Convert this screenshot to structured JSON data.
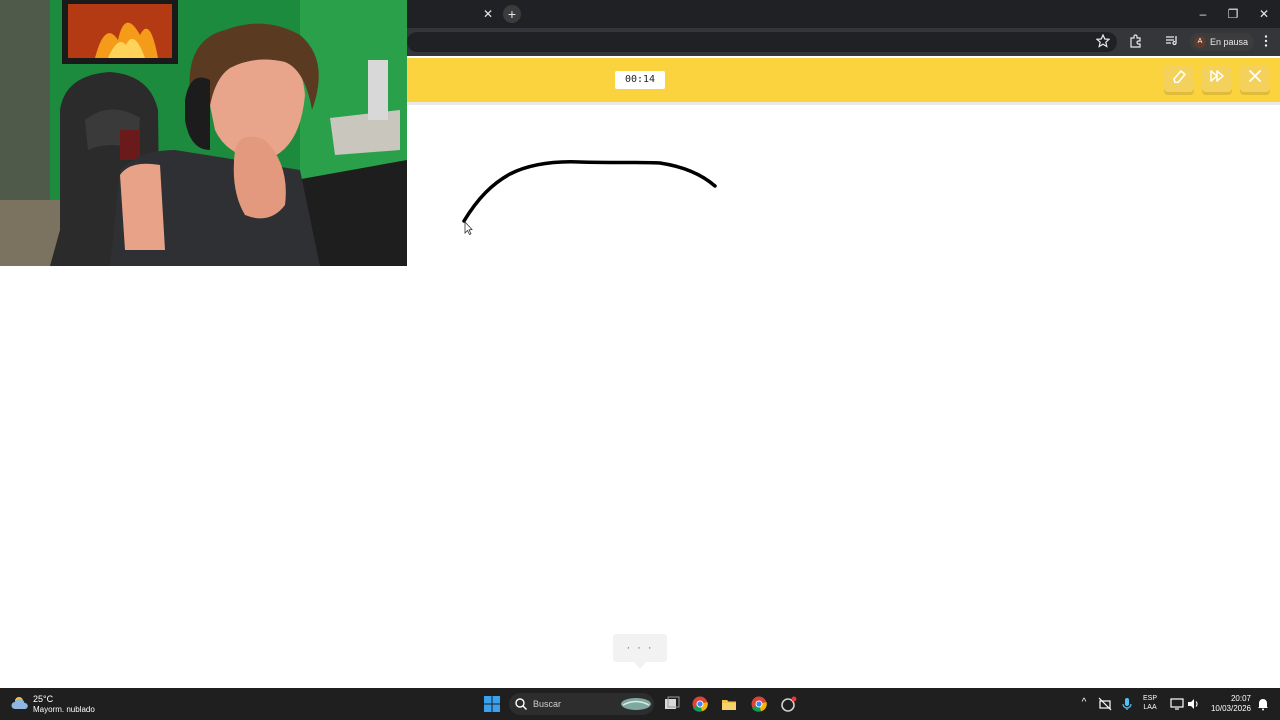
{
  "browser": {
    "tab_close": "✕",
    "new_tab": "+",
    "window": {
      "minimize": "–",
      "restore": "❐",
      "close": "✕"
    },
    "profile": {
      "initial": "A",
      "label": "En pausa"
    }
  },
  "game": {
    "timer": "00:14"
  },
  "canvas": {
    "overflow_label": "· · ·"
  },
  "taskbar": {
    "weather": {
      "temp": "25°C",
      "desc": "Mayorm. nublado"
    },
    "search_label": "Buscar",
    "language": {
      "line1": "ESP",
      "line2": "LAA"
    },
    "clock": {
      "time": "20:07",
      "date": "10/03/2026"
    }
  },
  "colors": {
    "accent_yellow": "#fbd33e",
    "chrome_dark": "#202124",
    "taskbar": "#1f1f1f"
  }
}
